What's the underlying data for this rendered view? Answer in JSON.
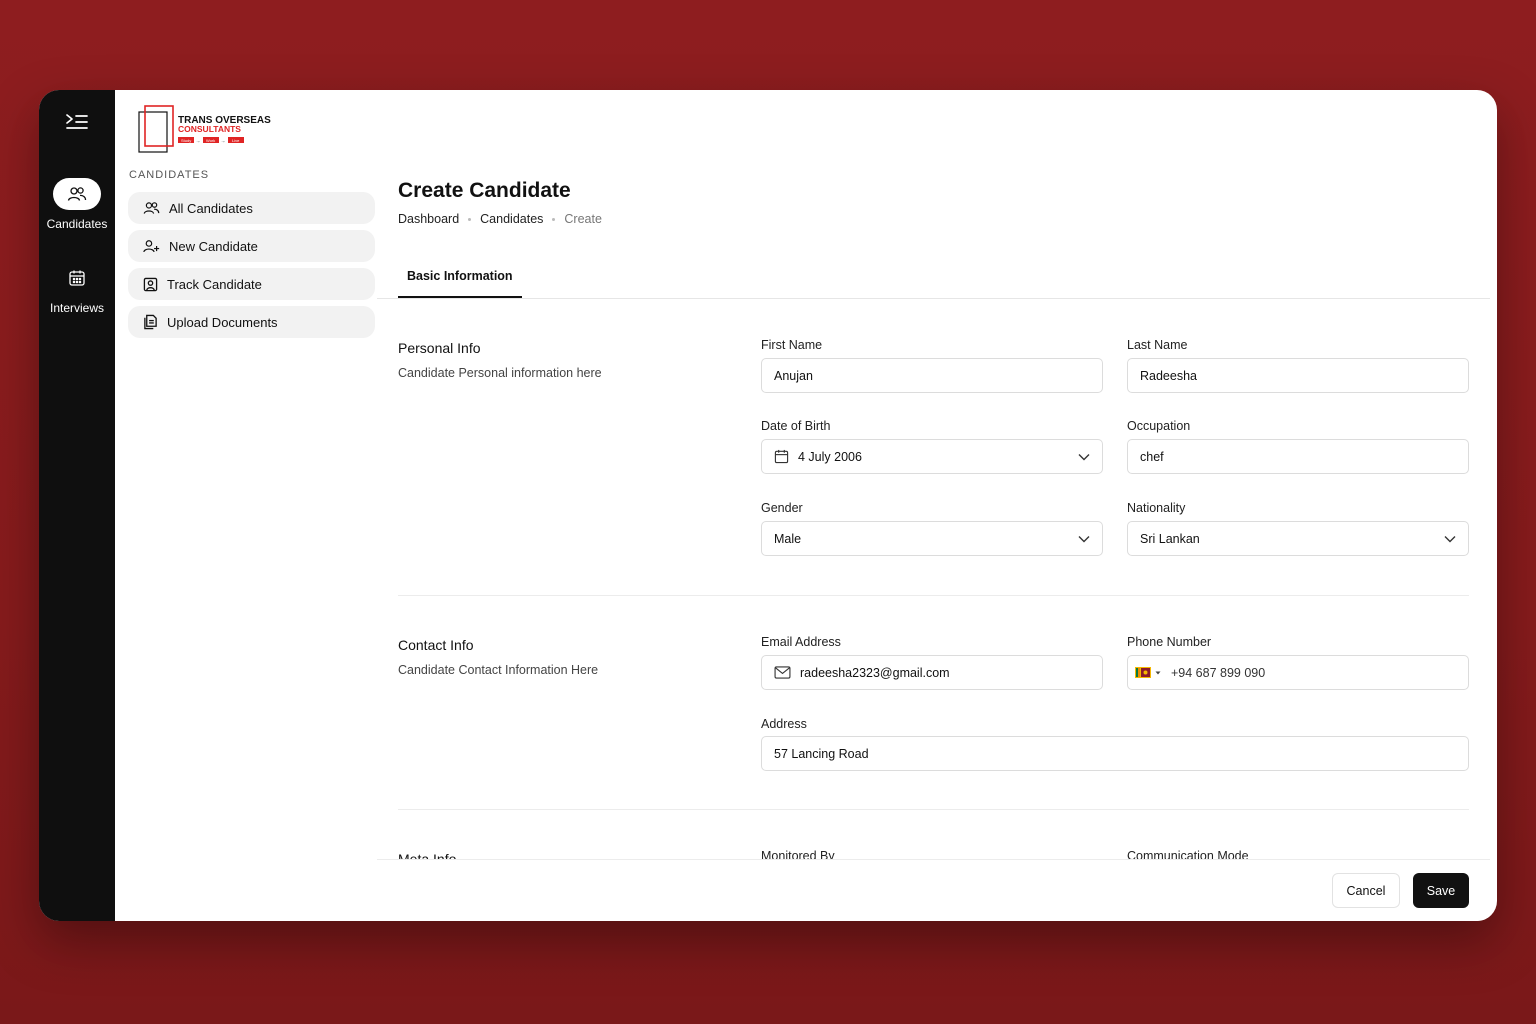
{
  "colors": {
    "background": "#8e1d1f",
    "rail": "#0f0f0f",
    "brand_red": "#e02424",
    "primary_button": "#111111"
  },
  "logo": {
    "line1": "TRANS OVERSEAS",
    "line2": "CONSULTANTS",
    "tags": [
      "Study",
      "Work",
      "Live"
    ]
  },
  "rail": {
    "menu_icon": "menu-indent-icon",
    "items": [
      {
        "label": "Candidates",
        "icon": "users-icon",
        "active": true
      },
      {
        "label": "Interviews",
        "icon": "calendar-icon",
        "active": false
      }
    ]
  },
  "subnav": {
    "section": "CANDIDATES",
    "items": [
      {
        "label": "All Candidates",
        "icon": "users-icon"
      },
      {
        "label": "New Candidate",
        "icon": "user-plus-icon"
      },
      {
        "label": "Track Candidate",
        "icon": "user-square-icon"
      },
      {
        "label": "Upload Documents",
        "icon": "documents-icon"
      }
    ]
  },
  "page": {
    "title": "Create Candidate",
    "breadcrumb": [
      "Dashboard",
      "Candidates",
      "Create"
    ],
    "tabs": [
      "Basic Information"
    ]
  },
  "personal": {
    "title": "Personal Info",
    "description": "Candidate Personal information here",
    "first_name": {
      "label": "First Name",
      "value": "Anujan"
    },
    "last_name": {
      "label": "Last Name",
      "value": "Radeesha"
    },
    "dob": {
      "label": "Date of Birth",
      "value": "4 July 2006"
    },
    "occupation": {
      "label": "Occupation",
      "value": "chef"
    },
    "gender": {
      "label": "Gender",
      "value": "Male"
    },
    "nationality": {
      "label": "Nationality",
      "value": "Sri Lankan"
    }
  },
  "contact": {
    "title": "Contact Info",
    "description": "Candidate Contact Information Here",
    "email": {
      "label": "Email Address",
      "value": "radeesha2323@gmail.com"
    },
    "phone": {
      "label": "Phone Number",
      "value": "+94 687 899 090",
      "country": "LK"
    },
    "address": {
      "label": "Address",
      "value": "57 Lancing Road"
    }
  },
  "meta": {
    "title": "Meta Info",
    "monitored_by_label": "Monitored By",
    "communication_mode_label": "Communication Mode"
  },
  "footer": {
    "cancel": "Cancel",
    "save": "Save"
  }
}
